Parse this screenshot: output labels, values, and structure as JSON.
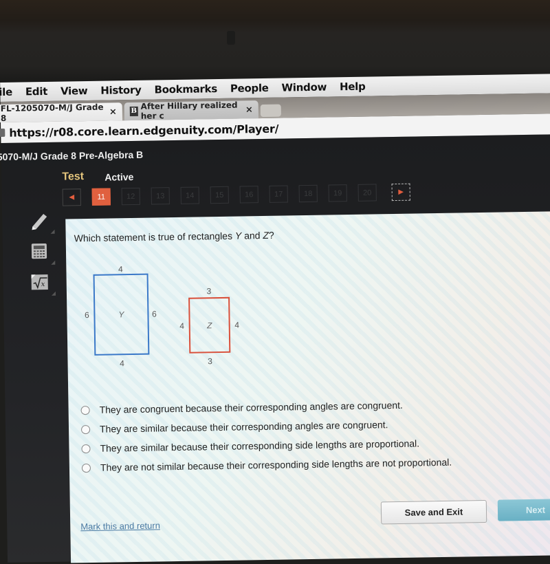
{
  "menubar": {
    "items": [
      "ile",
      "Edit",
      "View",
      "History",
      "Bookmarks",
      "People",
      "Window",
      "Help"
    ]
  },
  "tabs": [
    {
      "label": "FL-1205070-M/J Grade 8",
      "close": "×"
    },
    {
      "favicon": "B",
      "label": "After Hillary realized her c",
      "close": "×"
    }
  ],
  "address_bar": {
    "url": "https://r08.core.learn.edgenuity.com/Player/"
  },
  "app": {
    "course_title": "5070-M/J Grade 8 Pre-Algebra B",
    "mode_label": "Test",
    "status_label": "Active",
    "nav": {
      "prev_icon": "◀",
      "next_icon": "▶",
      "questions": [
        "11",
        "12",
        "13",
        "14",
        "15",
        "16",
        "17",
        "18",
        "19",
        "20"
      ],
      "current": "11"
    },
    "tools": [
      "pencil-icon",
      "calculator-icon",
      "sqrt-icon"
    ]
  },
  "question": {
    "text_prefix": "Which statement is true of rectangles ",
    "var1": "Y",
    "and": " and ",
    "var2": "Z",
    "text_suffix": "?"
  },
  "figure": {
    "rect_y": {
      "label": "Y",
      "top": "4",
      "bottom": "4",
      "left": "6",
      "right": "6",
      "color": "#3a78c8"
    },
    "rect_z": {
      "label": "Z",
      "top": "3",
      "bottom": "3",
      "left": "4",
      "right": "4",
      "color": "#d9503b"
    }
  },
  "answers": [
    "They are congruent because their corresponding angles are congruent.",
    "They are similar because their corresponding angles are congruent.",
    "They are similar because their corresponding side lengths are proportional.",
    "They are not similar because their corresponding side lengths are not proportional."
  ],
  "footer": {
    "mark_link": "Mark this and return",
    "save_button": "Save and Exit",
    "next_button": "Next"
  }
}
